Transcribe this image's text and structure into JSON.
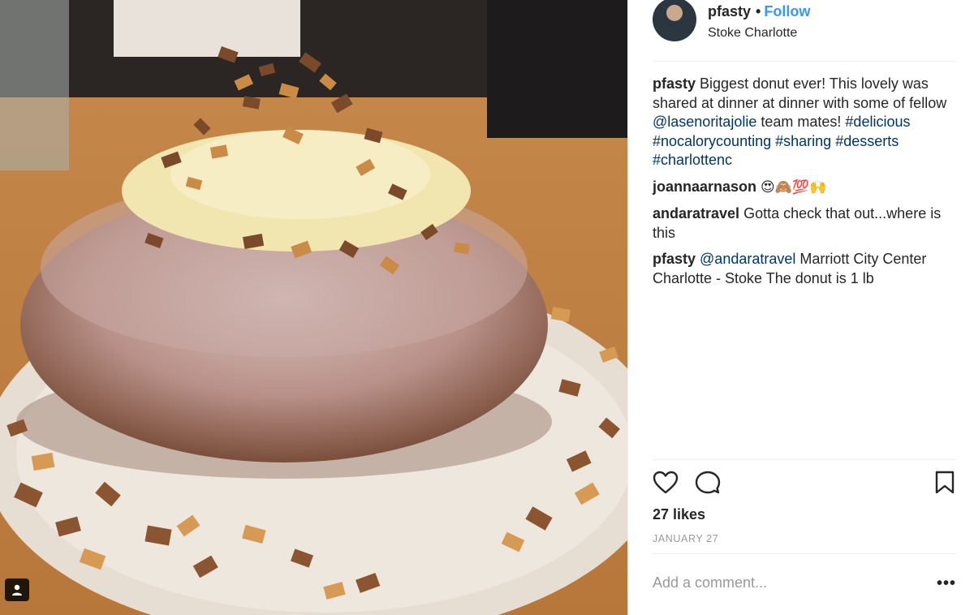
{
  "post": {
    "username": "pfasty",
    "follow_label": "Follow",
    "separator": "•",
    "location": "Stoke Charlotte",
    "likes": "27 likes",
    "date": "JANUARY 27",
    "add_comment_placeholder": "Add a comment...",
    "more_label": "•••"
  },
  "caption": {
    "user": "pfasty",
    "text_1": "Biggest donut ever! This lovely was shared at dinner at dinner with some of fellow",
    "mention": "@lasenoritajolie",
    "text_2": "team mates!",
    "hashtags": [
      "#delicious",
      "#nocalorycounting",
      "#sharing",
      "#desserts",
      "#charlottenc"
    ]
  },
  "comments": [
    {
      "user": "joannaarnason",
      "text": "😍🙈💯🙌"
    },
    {
      "user": "andaratravel",
      "text": "Gotta check that out...where is this"
    },
    {
      "user": "pfasty",
      "mention": "@andaratravel",
      "text": "Marriott City Center Charlotte - Stoke The donut is 1 lb"
    }
  ],
  "icons": {
    "like": "heart-icon",
    "comment": "comment-icon",
    "save": "bookmark-icon",
    "tagged": "user-tag-icon"
  },
  "colors": {
    "link_blue": "#3897f0",
    "hashtag": "#003569",
    "muted": "#999999",
    "text": "#262626"
  }
}
